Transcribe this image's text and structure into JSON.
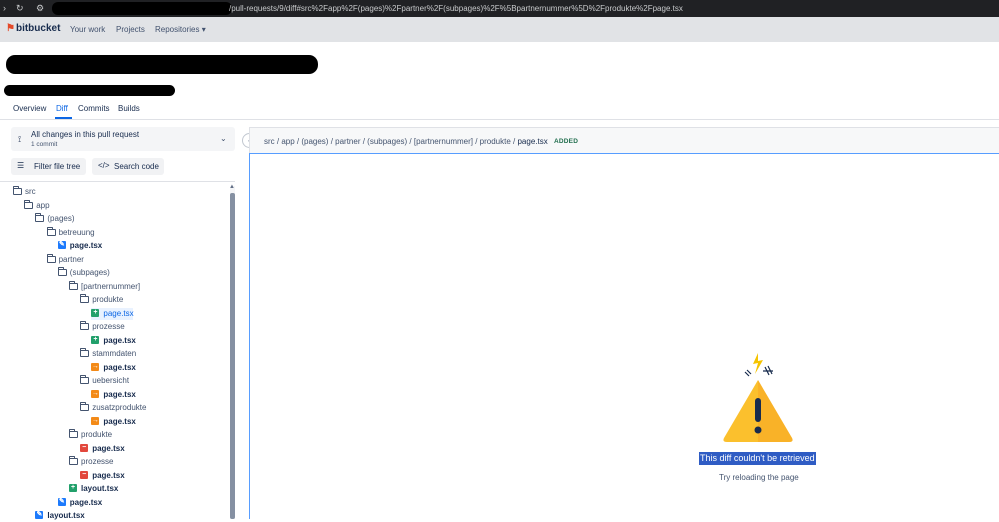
{
  "browser": {
    "url": "/pull-requests/9/diff#src%2Fapp%2F(pages)%2Fpartner%2F(subpages)%2F%5Bpartnernummer%5D%2Fprodukte%2Fpage.tsx",
    "back_icon": "chevron-right",
    "reload_icon": "reload",
    "site_icon": "tune"
  },
  "appbar": {
    "logo": "bitbucket",
    "nav": [
      "Your work",
      "Projects",
      "Repositories"
    ],
    "repositories_chevron": "▾"
  },
  "tabs": [
    "Overview",
    "Diff",
    "Commits",
    "Builds"
  ],
  "active_tab": "Diff",
  "sidebar": {
    "changes_title": "All changes in this pull request",
    "changes_sub": "1 commit",
    "filter_label": "Filter file tree",
    "search_label": "Search code",
    "tree": [
      {
        "name": "src",
        "kind": "folder",
        "depth": 0
      },
      {
        "name": "app",
        "kind": "folder",
        "depth": 1
      },
      {
        "name": "(pages)",
        "kind": "folder",
        "depth": 2
      },
      {
        "name": "betreuung",
        "kind": "folder",
        "depth": 3
      },
      {
        "name": "page.tsx",
        "kind": "modified",
        "depth": 4
      },
      {
        "name": "partner",
        "kind": "folder",
        "depth": 3
      },
      {
        "name": "(subpages)",
        "kind": "folder",
        "depth": 4
      },
      {
        "name": "[partnernummer]",
        "kind": "folder",
        "depth": 5
      },
      {
        "name": "produkte",
        "kind": "folder",
        "depth": 6
      },
      {
        "name": "page.tsx",
        "kind": "added",
        "depth": 7,
        "selected": true
      },
      {
        "name": "prozesse",
        "kind": "folder",
        "depth": 6
      },
      {
        "name": "page.tsx",
        "kind": "added",
        "depth": 7
      },
      {
        "name": "stammdaten",
        "kind": "folder",
        "depth": 6
      },
      {
        "name": "page.tsx",
        "kind": "renamed",
        "depth": 7
      },
      {
        "name": "uebersicht",
        "kind": "folder",
        "depth": 6
      },
      {
        "name": "page.tsx",
        "kind": "renamed",
        "depth": 7
      },
      {
        "name": "zusatzprodukte",
        "kind": "folder",
        "depth": 6
      },
      {
        "name": "page.tsx",
        "kind": "renamed",
        "depth": 7
      },
      {
        "name": "produkte",
        "kind": "folder",
        "depth": 5
      },
      {
        "name": "page.tsx",
        "kind": "deleted",
        "depth": 6
      },
      {
        "name": "prozesse",
        "kind": "folder",
        "depth": 5
      },
      {
        "name": "page.tsx",
        "kind": "deleted",
        "depth": 6
      },
      {
        "name": "layout.tsx",
        "kind": "added",
        "depth": 5
      },
      {
        "name": "page.tsx",
        "kind": "modified",
        "depth": 4
      },
      {
        "name": "layout.tsx",
        "kind": "modified",
        "depth": 2
      }
    ]
  },
  "file_header": {
    "path": "src / app / (pages) / partner / (subpages) / [partnernummer] / produkte /",
    "file": "page.tsx",
    "badge": "ADDED"
  },
  "error": {
    "title": "This diff couldn't be retrieved",
    "subtitle": "Try reloading the page"
  },
  "colors": {
    "accent": "#0c66e4",
    "added": "#22a06b",
    "deleted": "#e2483d",
    "renamed": "#f38a18",
    "modified": "#1d7afc",
    "warning": "#fbc02d"
  }
}
